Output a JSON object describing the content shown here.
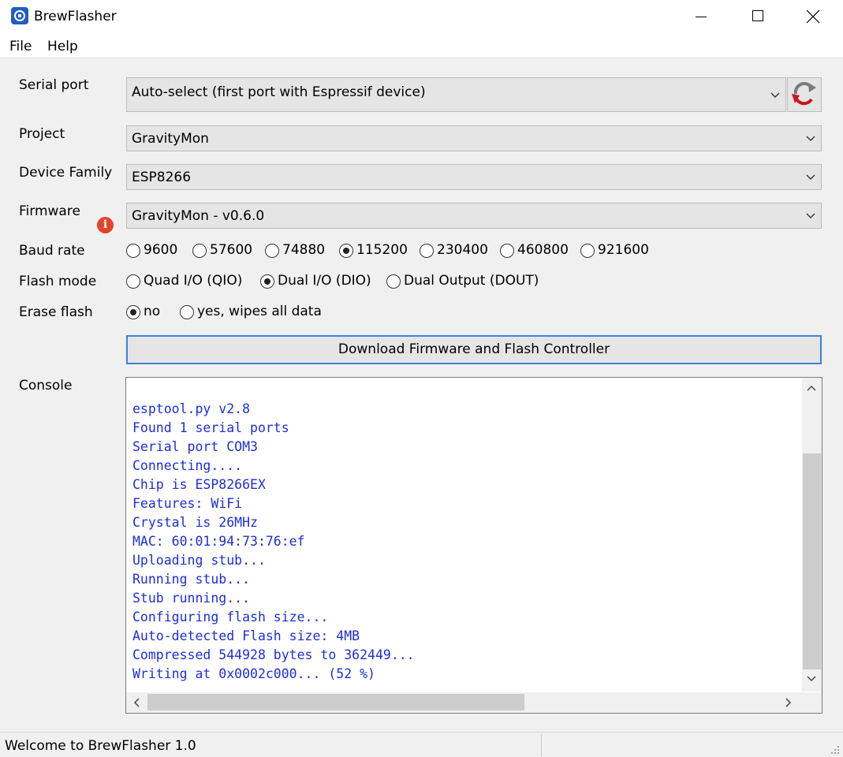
{
  "window": {
    "title": "BrewFlasher"
  },
  "menu": {
    "file": "File",
    "help": "Help"
  },
  "form": {
    "serial_port": {
      "label": "Serial port",
      "value": "Auto-select (first port with Espressif device)"
    },
    "project": {
      "label": "Project",
      "value": "GravityMon"
    },
    "device_family": {
      "label": "Device Family",
      "value": "ESP8266"
    },
    "firmware": {
      "label": "Firmware",
      "value": "GravityMon - v0.6.0"
    },
    "baud_rate": {
      "label": "Baud rate",
      "options": [
        "9600",
        "57600",
        "74880",
        "115200",
        "230400",
        "460800",
        "921600"
      ],
      "selected": "115200"
    },
    "flash_mode": {
      "label": "Flash mode",
      "options": [
        "Quad I/O (QIO)",
        "Dual I/O (DIO)",
        "Dual Output (DOUT)"
      ],
      "selected": "Dual I/O (DIO)"
    },
    "erase_flash": {
      "label": "Erase flash",
      "options": [
        "no",
        "yes, wipes all data"
      ],
      "selected": "no"
    }
  },
  "action_button": "Download Firmware and Flash Controller",
  "console": {
    "label": "Console",
    "lines": [
      "esptool.py v2.8",
      "Found 1 serial ports",
      "Serial port COM3",
      "Connecting....",
      "Chip is ESP8266EX",
      "Features: WiFi",
      "Crystal is 26MHz",
      "MAC: 60:01:94:73:76:ef",
      "Uploading stub...",
      "Running stub...",
      "Stub running...",
      "Configuring flash size...",
      "Auto-detected Flash size: 4MB",
      "Compressed 544928 bytes to 362449...",
      "Writing at 0x0002c000... (52 %)"
    ],
    "text_color": "#1e2ed8"
  },
  "status": {
    "text": "Welcome to BrewFlasher 1.0"
  },
  "colors": {
    "accent_border": "#3d82d6",
    "info_icon": "#e2442c",
    "refresh_arrow": "#c8161d"
  }
}
